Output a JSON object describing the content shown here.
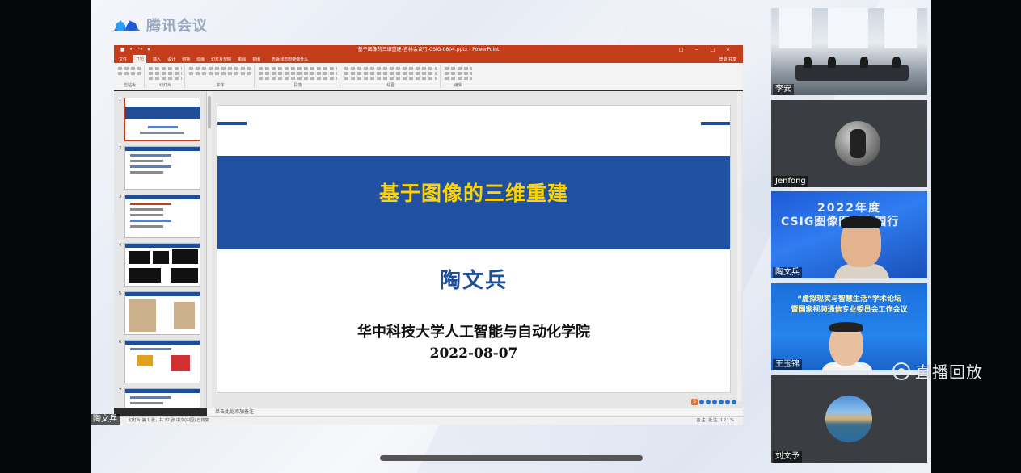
{
  "app": {
    "brand_name": "腾讯会议"
  },
  "shared_screen": {
    "presenter_tag": "陶文兵",
    "powerpoint": {
      "window_title": "基于图像的三维重建-吉林会议行-CSIG-0804.pptx - PowerPoint",
      "tabs": [
        "文件",
        "开始",
        "插入",
        "设计",
        "切换",
        "动画",
        "幻灯片放映",
        "审阅",
        "视图"
      ],
      "active_tab": "开始",
      "tell_me": "告诉我您想要做什么",
      "share_label": "登录  共享",
      "ribbon_groups": [
        "剪贴板",
        "幻灯片",
        "字体",
        "段落",
        "绘图",
        "编辑"
      ],
      "slide_numbers": [
        "1",
        "2",
        "3",
        "4",
        "5",
        "6",
        "7"
      ],
      "notes_placeholder": "单击此处添加备注",
      "status_left": "幻灯片 第 1 张，共 32 张   中文(中国)   已恢复",
      "status_right": "备注   批注         121%"
    },
    "slide": {
      "title": "基于图像的三维重建",
      "author": "陶文兵",
      "affiliation": "华中科技大学人工智能与自动化学院",
      "date": "2022-08-07"
    }
  },
  "participants": [
    {
      "name": "李安",
      "kind": "room-camera"
    },
    {
      "name": "Jenfong",
      "kind": "avatar"
    },
    {
      "name": "陶文兵",
      "kind": "camera",
      "background_lines": [
        "2022年度",
        "CSIG图像图形中国行"
      ]
    },
    {
      "name": "王玉锦",
      "kind": "camera",
      "background_lines": [
        "“虚拟现实与智慧生活”学术论坛",
        "暨国家视频通信专业委员会工作会议"
      ]
    },
    {
      "name": "刘文予",
      "kind": "avatar"
    }
  ],
  "replay": {
    "label": "直播回放"
  },
  "colors": {
    "ppt_accent": "#c43e1c",
    "slide_blue": "#2051a0",
    "slide_title": "#ffd200"
  }
}
